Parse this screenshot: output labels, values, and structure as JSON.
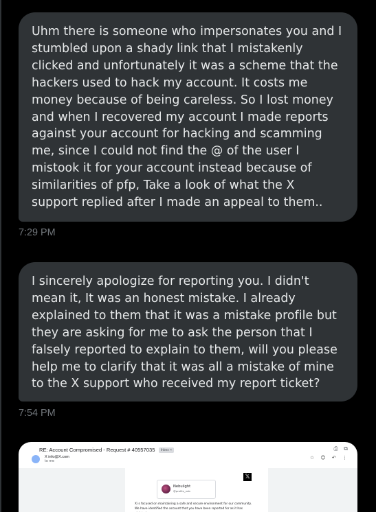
{
  "messages": [
    {
      "text": "Uhm there is someone who impersonates you and I stumbled upon a shady link that I mistakenly clicked and unfortunately it was a scheme that the hackers used to hack my account. It costs me money because of being careless. So I lost money and when I recovered my account I made reports against your account for hacking and scamming me, since I could not find the @ of the user I mistook it for your account instead because of similarities of pfp, Take a look of what the X support replied after I made an appeal to them..",
      "time": "7:29 PM"
    },
    {
      "text": "I sincerely apologize for reporting you. I didn't mean it, It was an honest mistake. I already explained to them that it was a mistake profile but they are asking for me to ask the person that I falsely reported to explain to them, will you please help me to clarify that it was all a mistake of mine to the X support who received my report ticket?",
      "time": "7:54 PM"
    }
  ],
  "attachment": {
    "subject": "RE: Account Compromised - Request # 40557035",
    "badge": "Inbox ×",
    "sender": "X  info@X.com",
    "to": "to me",
    "card_name": "Nebulight",
    "card_handle": "@profile_neb",
    "body": "X is focused on maintaining a safe and secure environment for our community. We have identified the account that you have been reported for as it has violated our",
    "x_logo": "𝕏",
    "tool_icons": [
      "print-icon",
      "open-in-new-icon"
    ],
    "action_icons": [
      "star-icon",
      "emoji-icon",
      "reply-icon",
      "more-vertical-icon"
    ]
  },
  "colors": {
    "background": "#000000",
    "bubble": "#2f3336",
    "text": "#e7e9ea",
    "timestamp": "#71767b"
  }
}
